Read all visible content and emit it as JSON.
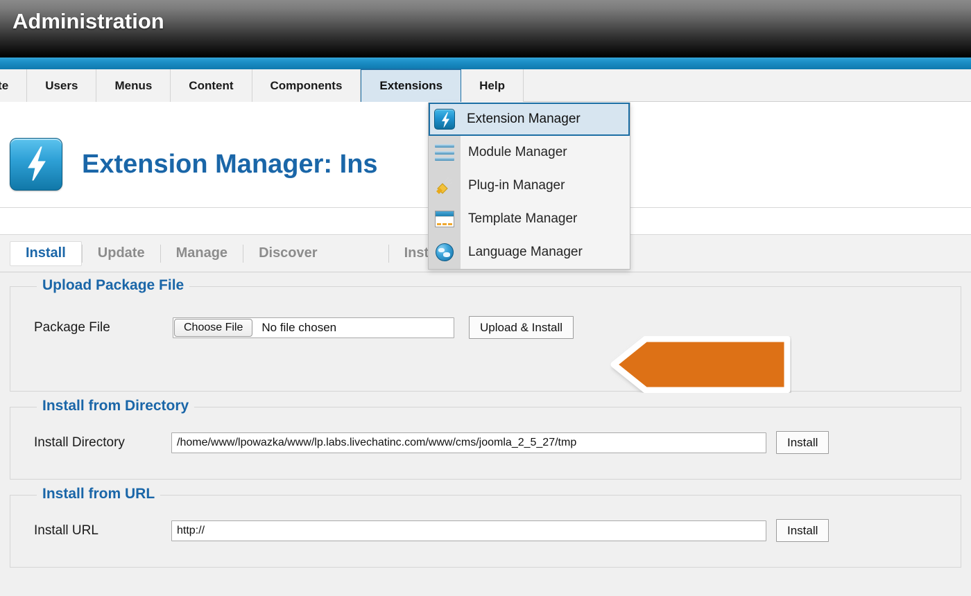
{
  "header": {
    "title": "Administration"
  },
  "menubar": {
    "items": [
      {
        "label": "Site",
        "active": false
      },
      {
        "label": "Users",
        "active": false
      },
      {
        "label": "Menus",
        "active": false
      },
      {
        "label": "Content",
        "active": false
      },
      {
        "label": "Components",
        "active": false
      },
      {
        "label": "Extensions",
        "active": true
      },
      {
        "label": "Help",
        "active": false
      }
    ]
  },
  "dropdown": {
    "open_for": "Extensions",
    "items": [
      {
        "label": "Extension Manager",
        "icon": "lightning-bolt-icon",
        "highlighted": true
      },
      {
        "label": "Module Manager",
        "icon": "stacked-bars-icon",
        "highlighted": false
      },
      {
        "label": "Plug-in Manager",
        "icon": "plug-icon",
        "highlighted": false
      },
      {
        "label": "Template Manager",
        "icon": "template-layout-icon",
        "highlighted": false
      },
      {
        "label": "Language Manager",
        "icon": "globe-icon",
        "highlighted": false
      }
    ]
  },
  "page": {
    "icon": "lightning-bolt-icon",
    "title": "Extension Manager: Ins"
  },
  "tabs": {
    "items": [
      {
        "label": "Install",
        "active": true
      },
      {
        "label": "Update",
        "active": false
      },
      {
        "label": "Manage",
        "active": false
      },
      {
        "label": "Discover",
        "active": false
      }
    ],
    "right_items": [
      {
        "label": "Install languages",
        "active": false
      }
    ]
  },
  "sections": {
    "upload": {
      "legend": "Upload Package File",
      "label": "Package File",
      "choose_button": "Choose File",
      "file_status": "No file chosen",
      "submit_button": "Upload & Install"
    },
    "directory": {
      "legend": "Install from Directory",
      "label": "Install Directory",
      "value": "/home/www/lpowazka/www/lp.labs.livechatinc.com/www/cms/joomla_2_5_27/tmp",
      "submit_button": "Install"
    },
    "url": {
      "legend": "Install from URL",
      "label": "Install URL",
      "value": "http://",
      "submit_button": "Install"
    }
  },
  "annotation": {
    "type": "arrow-callout",
    "points_to": "Upload & Install",
    "direction": "left",
    "fill_color": "#dd7112",
    "border_color": "#ffffff"
  },
  "colors": {
    "accent_blue": "#1a66a8",
    "bar_blue": "#1a8cc4",
    "header_dark": "#0d0d0d",
    "page_bg": "#f0f0f0",
    "orange": "#dd7112"
  }
}
